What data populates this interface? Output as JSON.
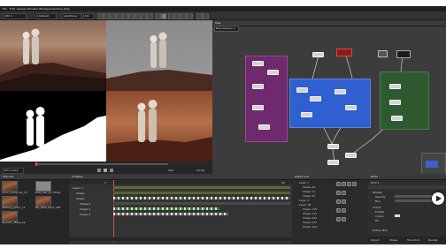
{
  "menu": [
    "File",
    "Edit",
    "Session",
    "Window",
    "Workspace",
    "Actions",
    "Help"
  ],
  "toolbar": {
    "view_selector": "Ctrl 1",
    "channel_selector": "Default",
    "mode_selector": "Autofocus",
    "zoom": "1/1"
  },
  "viewer": {
    "frame_current": "1",
    "view_mode": "Film Looks",
    "frame_end": "100",
    "fps": "24 fps"
  },
  "node_graph": {
    "title": "Tree",
    "tab": "New Session 1"
  },
  "sequence": {
    "title": "Clip List",
    "clips": [
      {
        "label": "Actor_Comp_02_v5"
      },
      {
        "label": "Roto_Ref_01_Wires"
      },
      {
        "label": "Walking_Actor_v1"
      },
      {
        "label": "BG_Roto_Dust_v08"
      },
      {
        "label": "Moutain_Mesa_v9"
      }
    ]
  },
  "timeline": {
    "title": "Timeline",
    "tracks": [
      "Layer 1",
      "Shape",
      "Shape",
      "Shape 2",
      "Shape 2",
      "Shape 2"
    ],
    "frame_start": "1",
    "frame_end": "99"
  },
  "object_list": {
    "title": "Object List",
    "rows": [
      "Layer 1",
      "Shape 12",
      "Shape 11",
      "Shape 10",
      "Layer 5",
      "Layer 78",
      "Shape 115",
      "Shape 113",
      "Shape 120",
      "Shape 121",
      "Shape 122"
    ]
  },
  "properties": {
    "title": "Node",
    "node_name": "Roto 1",
    "section_1": "Display",
    "field_1": "Opacity",
    "field_2": "Blur",
    "section_2": "Colour",
    "field_3": "Enable",
    "field_4": "Colour",
    "field_5": "Fill",
    "section_3": "Motion Blur",
    "tabs": [
      "Object",
      "Shape",
      "Transform",
      "Render"
    ]
  }
}
